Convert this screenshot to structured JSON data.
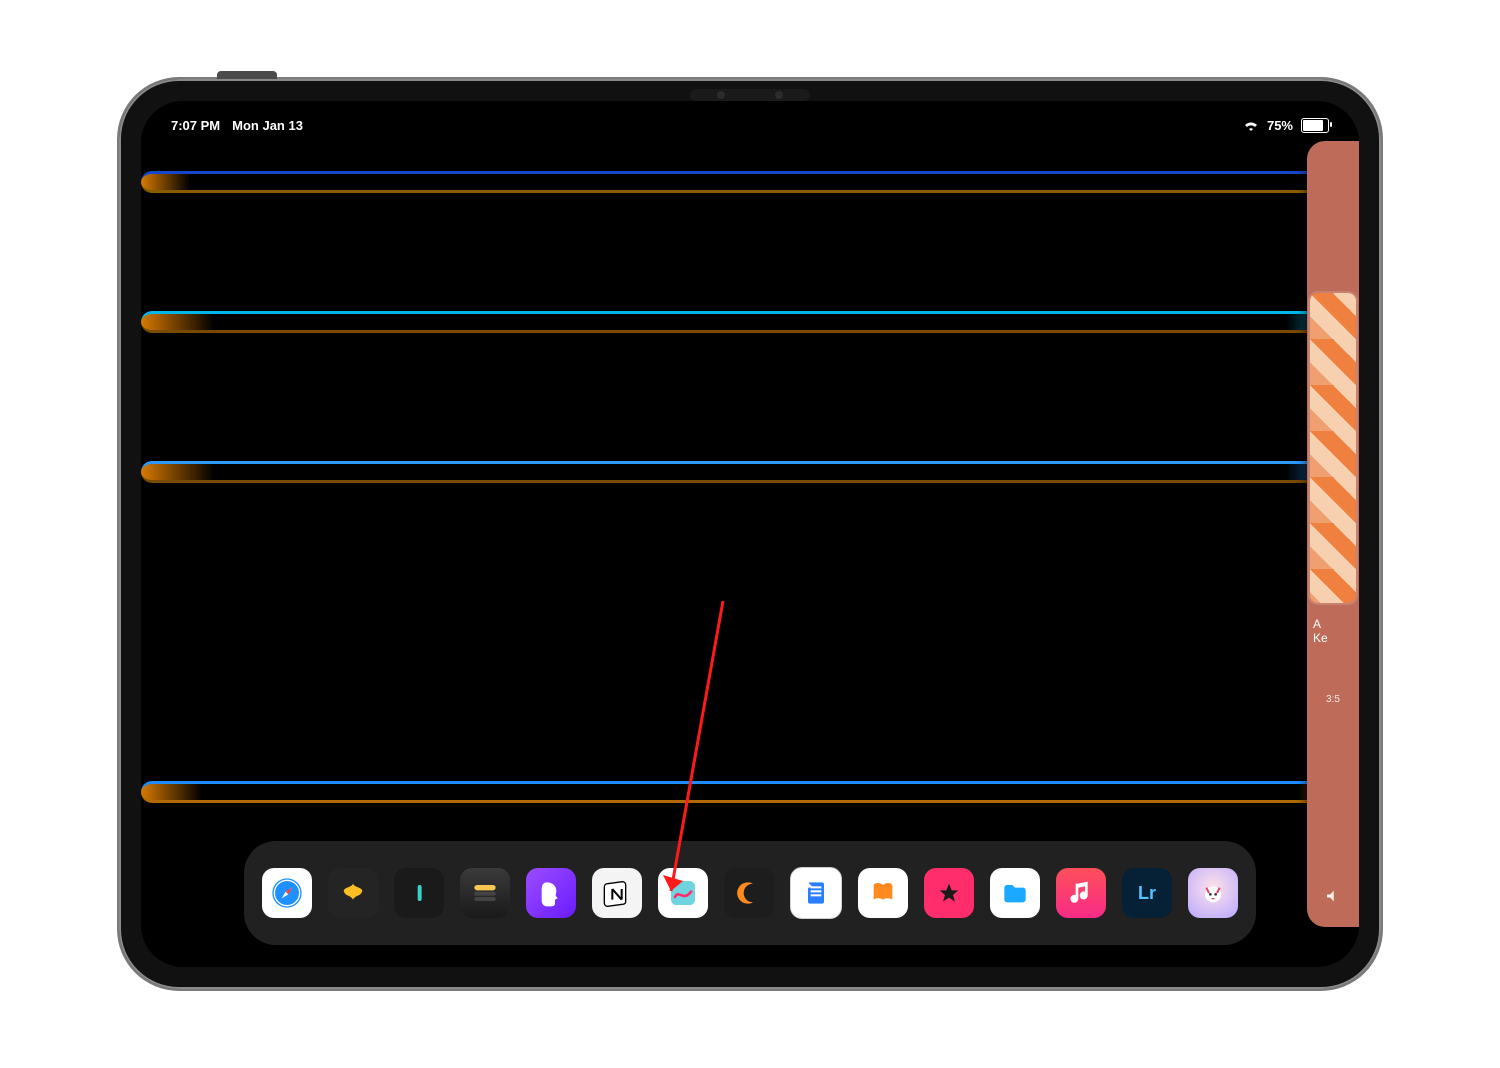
{
  "status": {
    "time": "7:07 PM",
    "date": "Mon Jan 13",
    "battery_pct": "75%"
  },
  "dock": {
    "apps": [
      {
        "name": "safari",
        "label": "Safari"
      },
      {
        "name": "butterfly",
        "label": "Butterfly app"
      },
      {
        "name": "line",
        "label": "Line app"
      },
      {
        "name": "wallet",
        "label": "Wallet-style app"
      },
      {
        "name": "face",
        "label": "Head profile app"
      },
      {
        "name": "notion",
        "label": "Notion"
      },
      {
        "name": "freeform",
        "label": "Freeform"
      },
      {
        "name": "cmoon",
        "label": "Orange C app"
      },
      {
        "name": "scan",
        "label": "Scanner / Document app"
      },
      {
        "name": "books",
        "label": "Books"
      },
      {
        "name": "star",
        "label": "Pink star app"
      },
      {
        "name": "files",
        "label": "Files"
      },
      {
        "name": "music",
        "label": "Music"
      },
      {
        "name": "lr",
        "label": "Lightroom",
        "text": "Lr"
      },
      {
        "name": "avatar",
        "label": "Avatar / Playground app"
      }
    ]
  },
  "slideover": {
    "title_line1": "A",
    "title_line2": "Ke",
    "timestamp": "3:5"
  },
  "annotation": {
    "target_app": "notion"
  }
}
